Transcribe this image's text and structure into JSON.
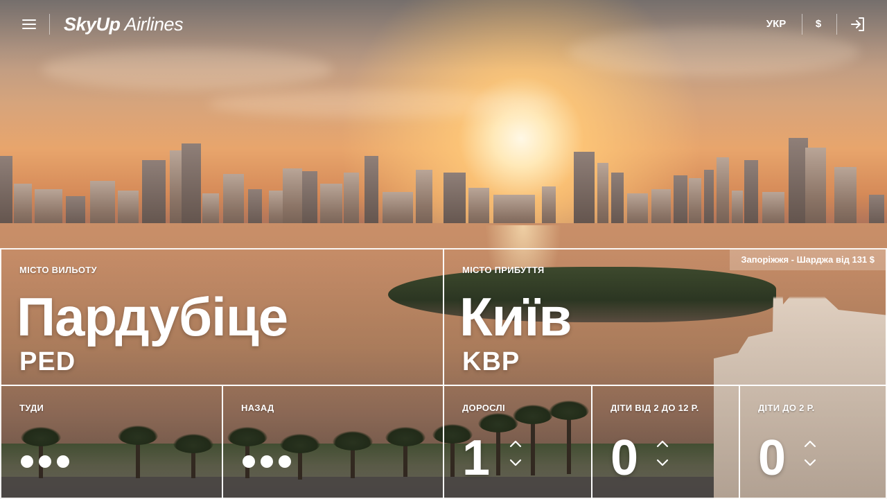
{
  "header": {
    "logo_brand": "SkyUp",
    "logo_suffix": "Airlines",
    "language_label": "УКР",
    "currency_label": "$"
  },
  "promo": {
    "text": "Запоріжжя - Шарджа від 131 $"
  },
  "departure": {
    "label": "МІСТО ВИЛЬОТУ",
    "city": "Пардубіце",
    "code": "PED"
  },
  "arrival": {
    "label": "МІСТО ПРИБУТТЯ",
    "city": "Київ",
    "code": "KBP"
  },
  "dates": {
    "outbound_label": "ТУДИ",
    "return_label": "НАЗАД"
  },
  "passengers": {
    "adults": {
      "label": "ДОРОСЛІ",
      "count": "1"
    },
    "children": {
      "label": "ДІТИ ВІД 2 ДО 12 Р.",
      "count": "0"
    },
    "infants": {
      "label": "ДІТИ ДО 2 Р.",
      "count": "0"
    }
  },
  "icons": {
    "menu": "hamburger-menu-icon",
    "login": "login-icon",
    "increase": "chevron-up-icon",
    "decrease": "chevron-down-icon"
  },
  "colors": {
    "text": "#ffffff",
    "border": "#ffffff"
  }
}
